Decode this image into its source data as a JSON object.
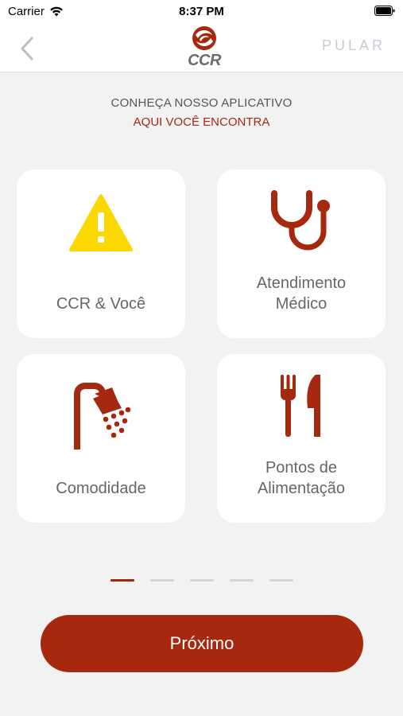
{
  "status_bar": {
    "carrier": "Carrier",
    "time": "8:37 PM"
  },
  "nav": {
    "logo_text": "CCR",
    "skip_label": "PULAR"
  },
  "intro": {
    "title": "CONHEÇA NOSSO APLICATIVO",
    "subtitle": "AQUI VOCÊ ENCONTRA"
  },
  "cards": [
    {
      "line1": "CCR & Você",
      "line2": "",
      "icon": "warning-icon"
    },
    {
      "line1": "Atendimento",
      "line2": "Médico",
      "icon": "stethoscope-icon"
    },
    {
      "line1": "Comodidade",
      "line2": "",
      "icon": "shower-icon"
    },
    {
      "line1": "Pontos de",
      "line2": "Alimentação",
      "icon": "fork-knife-icon"
    }
  ],
  "pager": {
    "count": 5,
    "active_index": 0
  },
  "next_button": {
    "label": "Próximo"
  },
  "colors": {
    "accent": "#a6290f",
    "warning": "#fcd800",
    "background": "#f2f2f2"
  }
}
